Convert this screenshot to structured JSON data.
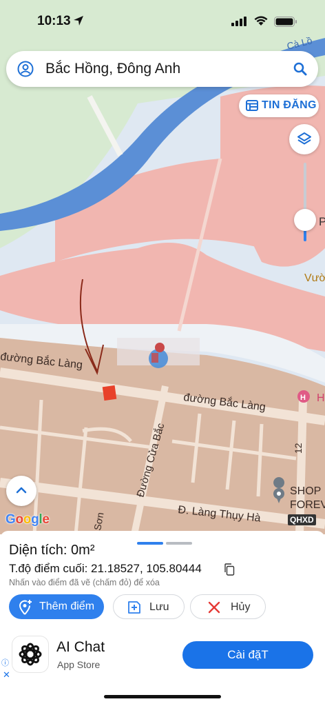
{
  "status_bar": {
    "time": "10:13"
  },
  "search": {
    "query": "Bắc Hồng, Đông Anh"
  },
  "map": {
    "tin_dang_label": "TIN ĐĂNG",
    "labels": {
      "canal": "Cà Lồ",
      "road_bac_lang_left": "đường Bắc Làng",
      "road_bac_lang_right": "đường Bắc Làng",
      "road_cua_bac": "Đường Cửa Bắc",
      "road_lang_thuy_ha": "Đ. Làng Thụy Hà",
      "road_son": "Sơn",
      "road_12": "12",
      "shop": "SHOP",
      "shop2": "FOREV",
      "vuon": "Vườ",
      "p": "P",
      "h": "H"
    },
    "google": "Google",
    "qhxd": "QHXD",
    "colors": {
      "green": "#d7ead1",
      "pink": "#f1b6b0",
      "water": "#5b8fd6",
      "light_water": "#dfe8f2",
      "beige": "#d9b8a3",
      "road": "#f2e3d6"
    },
    "zoom_slider_fraction": 0.25
  },
  "panel": {
    "area_label": "Diện tích: 0m²",
    "coord_label": "T.độ điểm cuối: 21.18527, 105.80444",
    "hint": "Nhấn vào điểm đã vẽ (chấm đỏ) để xóa",
    "add_point": "Thêm điểm",
    "save": "Lưu",
    "cancel": "Hủy"
  },
  "ad": {
    "title": "AI Chat",
    "subtitle": "App Store",
    "install": "Cài đặT"
  }
}
